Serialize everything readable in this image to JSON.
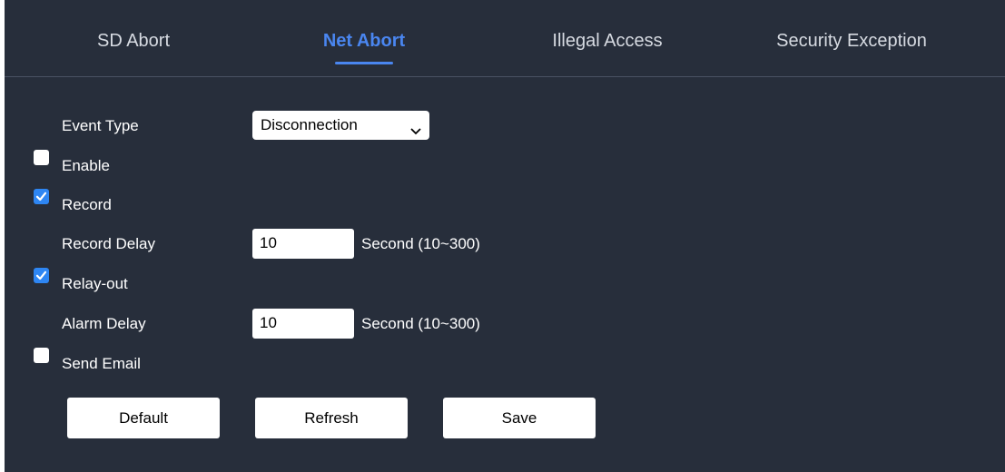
{
  "tabs": [
    {
      "label": "SD Abort",
      "active": false
    },
    {
      "label": "Net Abort",
      "active": true
    },
    {
      "label": "Illegal Access",
      "active": false
    },
    {
      "label": "Security Exception",
      "active": false
    }
  ],
  "colors": {
    "background": "#272e3b",
    "active_tab": "#4a86f0",
    "checkbox_checked": "#2e86f3"
  },
  "form": {
    "event_type": {
      "label": "Event Type",
      "value": "Disconnection",
      "icon": "chevron-down-icon"
    },
    "enable": {
      "label": "Enable",
      "checked": false
    },
    "record": {
      "label": "Record",
      "checked": true
    },
    "record_delay": {
      "label": "Record Delay",
      "value": "10",
      "unit": "Second (10~300)"
    },
    "relay_out": {
      "label": "Relay-out",
      "checked": true
    },
    "alarm_delay": {
      "label": "Alarm Delay",
      "value": "10",
      "unit": "Second (10~300)"
    },
    "send_email": {
      "label": "Send Email",
      "checked": false
    }
  },
  "buttons": {
    "default_label": "Default",
    "refresh_label": "Refresh",
    "save_label": "Save"
  }
}
